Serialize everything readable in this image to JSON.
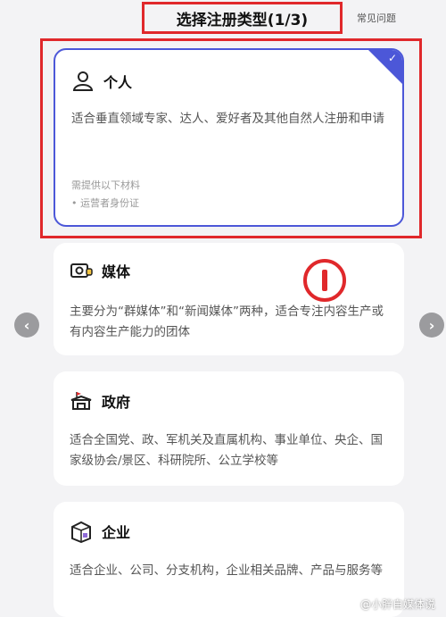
{
  "header": {
    "title": "选择注册类型(1/3)",
    "help_label": "常见问题"
  },
  "cards": [
    {
      "icon": "person-icon",
      "title": "个人",
      "desc": "适合垂直领域专家、达人、爱好者及其他自然人注册和申请",
      "note_title": "需提供以下材料",
      "note_item": "• 运营者身份证",
      "selected": true
    },
    {
      "icon": "media-icon",
      "title": "媒体",
      "desc": "主要分为“群媒体”和“新闻媒体”两种，适合专注内容生产或有内容生产能力的团体"
    },
    {
      "icon": "government-icon",
      "title": "政府",
      "desc": "适合全国党、政、军机关及直属机构、事业单位、央企、国家级协会/景区、科研院所、公立学校等"
    },
    {
      "icon": "enterprise-icon",
      "title": "企业",
      "desc": "适合企业、公司、分支机构，企业相关品牌、产品与服务等"
    }
  ],
  "nav": {
    "prev_symbol": "‹",
    "next_symbol": "›"
  },
  "watermark": "@小胖自媒体说",
  "colors": {
    "accent": "#4c57d8",
    "annotation_red": "#e0282b"
  }
}
